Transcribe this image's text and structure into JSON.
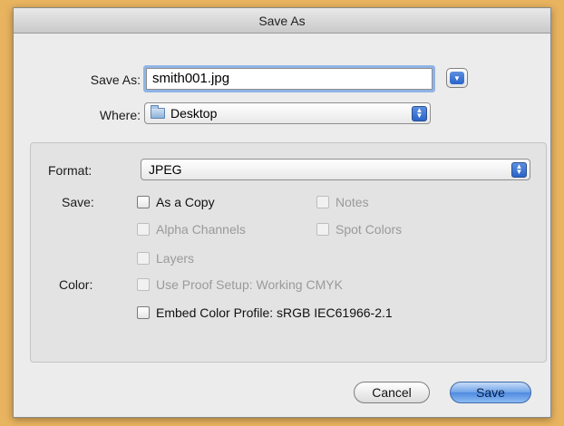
{
  "window": {
    "title": "Save As"
  },
  "save_as": {
    "label": "Save As:",
    "value": "smith001.jpg"
  },
  "where": {
    "label": "Where:",
    "value": "Desktop"
  },
  "format": {
    "label": "Format:",
    "value": "JPEG"
  },
  "save_options": {
    "label": "Save:",
    "as_a_copy": "As a Copy",
    "notes": "Notes",
    "alpha_channels": "Alpha Channels",
    "spot_colors": "Spot Colors",
    "layers": "Layers"
  },
  "color_options": {
    "label": "Color:",
    "use_proof_setup": "Use Proof Setup:  Working CMYK",
    "embed_color_profile": "Embed Color Profile:  sRGB IEC61966-2.1"
  },
  "buttons": {
    "cancel": "Cancel",
    "save": "Save"
  },
  "icons": {
    "disclosure": "chevron-down-icon",
    "stepper": "up-down-arrows-icon",
    "folder": "folder-icon"
  },
  "colors": {
    "desktop_bg": "#e9b45f",
    "accent": "#4f8ae0"
  }
}
